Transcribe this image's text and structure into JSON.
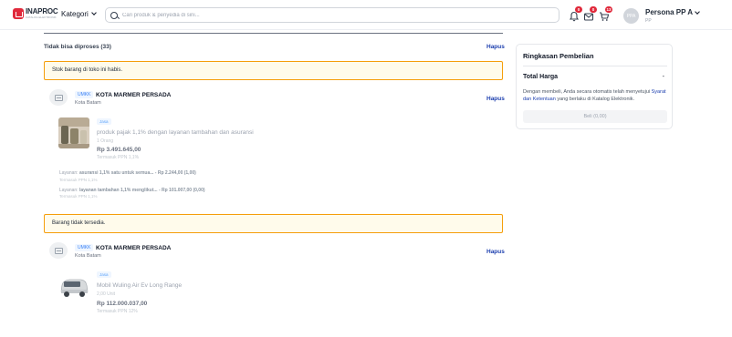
{
  "header": {
    "logo_title": "INAPROC",
    "logo_sub": "KATALOG ELEKTRONIK",
    "kategori_label": "Kategori",
    "search_placeholder": "Cari produk & penyedia di sini...",
    "notif_count": "0",
    "mail_count": "0",
    "cart_count": "13",
    "avatar_initials": "PPA",
    "user_name": "Persona PP A",
    "user_role": "PP"
  },
  "main": {
    "section_title": "Tidak bisa diproses (33)",
    "hapus_label": "Hapus",
    "groups": [
      {
        "alert": "Stok barang di toko ini habis.",
        "store_badge": "UMKK",
        "store_name": "KOTA MARMER PERSADA",
        "store_location": "Kota Batam",
        "hapus": "Hapus",
        "product": {
          "tag": "Jasa",
          "name": "produk pajak 1,1% dengan layanan tambahan dan asuransi",
          "qty": "1 Orang",
          "price": "Rp 3.491.645,00",
          "ppn": "Termasuk PPN 1,1%"
        },
        "services": [
          {
            "prefix": "Layanan:",
            "detail": "asuransi 1,1% satu untuk semua... - Rp 2.244,00 (1,00)",
            "ppn": "Termasuk PPN 1,1%"
          },
          {
            "prefix": "Layanan:",
            "detail": "layanan tambahan 1,1% menglikut... - Rp 101.007,00 (0,00)",
            "ppn": "Termasuk PPN 1,1%"
          }
        ]
      },
      {
        "alert": "Barang tidak tersedia.",
        "store_badge": "UMKK",
        "store_name": "KOTA MARMER PERSADA",
        "store_location": "Kota Batam",
        "hapus": "Hapus",
        "product": {
          "tag": "Jasa",
          "name": "Mobil Wuling Air Ev Long Range",
          "qty": "2,00 Unit",
          "price": "Rp 112.000.037,00",
          "ppn": "Termasuk PPN 12%"
        }
      }
    ]
  },
  "summary": {
    "title": "Ringkasan Pembelian",
    "total_label": "Total Harga",
    "total_value": "-",
    "text_before": "Dengan membeli, Anda secara otomatis telah menyetujui ",
    "link_text": "Syarat dan Ketentuan",
    "text_after": " yang berlaku di Katalog Elektronik.",
    "buy_label": "Beli (0,00)"
  },
  "colors": {
    "brand_red": "#e0293b",
    "link_blue": "#1e40af",
    "alert_border": "#f59e0b",
    "alert_bg": "#fffbeb"
  },
  "icons": [
    "inaproc-logo",
    "chevron-down-icon",
    "search-icon",
    "bell-icon",
    "mail-icon",
    "cart-icon",
    "store-icon"
  ]
}
